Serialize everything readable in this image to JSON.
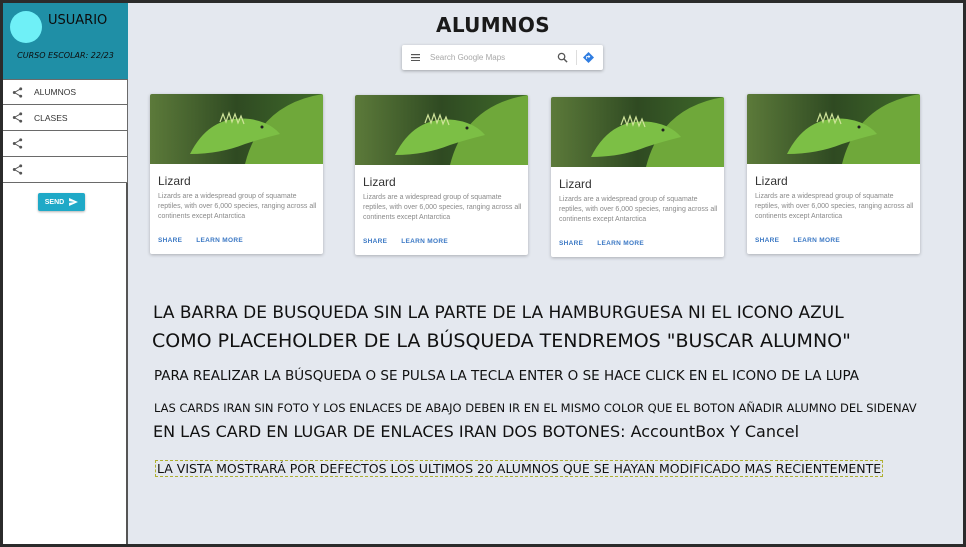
{
  "sidebar": {
    "user_name": "USUARIO",
    "school_year": "CURSO ESCOLAR: 22/23",
    "items": [
      {
        "label": "ALUMNOS",
        "icon": "share-icon"
      },
      {
        "label": "CLASES",
        "icon": "share-icon"
      },
      {
        "label": "",
        "icon": "share-icon"
      },
      {
        "label": "",
        "icon": "share-icon"
      }
    ],
    "send_label": "SEND",
    "header_color": "#1f8fa6",
    "avatar_color": "#6ff0f7",
    "button_color": "#1fa9c7"
  },
  "main": {
    "title": "ALUMNOS",
    "search": {
      "placeholder": "Search Google Maps"
    },
    "cards": [
      {
        "title": "Lizard",
        "text": "Lizards are a widespread group of squamate reptiles, with over 6,000 species, ranging across all continents except Antarctica",
        "share": "SHARE",
        "learn_more": "LEARN MORE"
      },
      {
        "title": "Lizard",
        "text": "Lizards are a widespread group of squamate reptiles, with over 6,000 species, ranging across all continents except Antarctica",
        "share": "SHARE",
        "learn_more": "LEARN MORE"
      },
      {
        "title": "Lizard",
        "text": "Lizards are a widespread group of squamate reptiles, with over 6,000 species, ranging across all continents except Antarctica",
        "share": "SHARE",
        "learn_more": "LEARN MORE"
      },
      {
        "title": "Lizard",
        "text": "Lizards are a widespread group of squamate reptiles, with over 6,000 species, ranging across all continents except Antarctica",
        "share": "SHARE",
        "learn_more": "LEARN MORE"
      }
    ],
    "notes": [
      "LA BARRA DE BUSQUEDA SIN LA PARTE DE LA HAMBURGUESA NI EL ICONO AZUL",
      "COMO PLACEHOLDER DE LA BÚSQUEDA TENDREMOS \"BUSCAR ALUMNO\"",
      "PARA REALIZAR LA BÚSQUEDA O SE PULSA LA TECLA ENTER O SE HACE CLICK EN EL ICONO DE LA LUPA",
      "LAS CARDS IRAN SIN FOTO Y LOS ENLACES DE ABAJO DEBEN IR EN EL MISMO COLOR QUE EL BOTON AÑADIR ALUMNO DEL SIDENAV",
      "EN LAS CARD EN LUGAR DE ENLACES IRAN DOS BOTONES: AccountBox Y Cancel",
      "LA VISTA MOSTRARÁ POR DEFECTOS LOS ULTIMOS 20 ALUMNOS QUE SE HAYAN MODIFICADO MAS RECIENTEMENTE"
    ],
    "link_color": "#3b78c4"
  }
}
